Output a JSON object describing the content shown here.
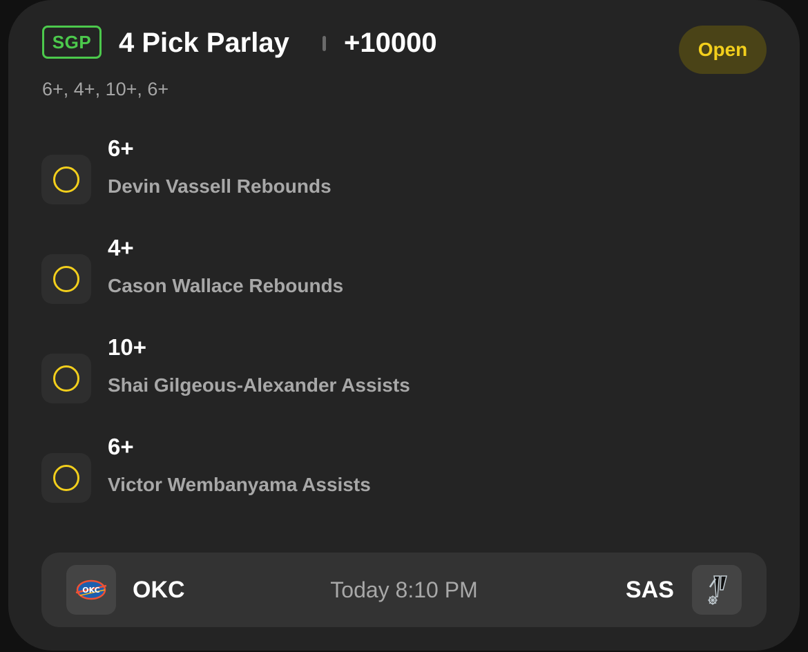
{
  "header": {
    "badge": "SGP",
    "title": "4 Pick Parlay",
    "odds": "+10000",
    "status": "Open",
    "summary": "6+, 4+, 10+, 6+"
  },
  "picks": [
    {
      "line": "6+",
      "description": "Devin Vassell Rebounds"
    },
    {
      "line": "4+",
      "description": "Cason Wallace Rebounds"
    },
    {
      "line": "10+",
      "description": "Shai Gilgeous-Alexander Assists"
    },
    {
      "line": "6+",
      "description": "Victor Wembanyama Assists"
    }
  ],
  "game": {
    "away_team": "OKC",
    "home_team": "SAS",
    "time": "Today 8:10 PM",
    "away_logo_icon": "okc-thunder-logo-icon",
    "home_logo_icon": "spurs-logo-icon"
  },
  "colors": {
    "card_bg": "#242424",
    "sgp_green": "#4cc94c",
    "pending_yellow": "#f3cf1c",
    "open_pill_bg": "#4a4317"
  }
}
